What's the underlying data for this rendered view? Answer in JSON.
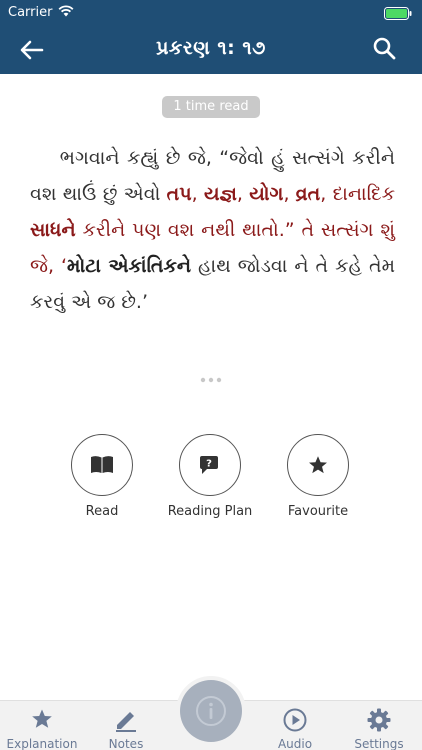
{
  "status_bar": {
    "carrier": "Carrier"
  },
  "nav": {
    "title": "પ્રકરણ ૧: ૧૭"
  },
  "read_badge": "1 time read",
  "verse": {
    "p1": "ભગવાને કહ્યું છે જે, “જેવો હું સત્સંગે કરીને વશ થાઉં છું એવો ",
    "k1": "તપ",
    "s1": ", ",
    "k2": "યજ્ઞ",
    "s2": ", ",
    "k3": "યોગ",
    "s3": ", ",
    "k4": "વ્રત",
    "p2": ", દાનાદિક ",
    "k5": "સાધને",
    "p3": " કરીને પણ વશ નથી થાતો.” તે સત્સંગ શું જે, ‘",
    "k6": "મોટા એકાંતિકને",
    "p4": " હાથ જોડવા ને તે કહે તેમ કરવું એ જ છે.’"
  },
  "actions": [
    {
      "label": "Read",
      "icon": "book-icon"
    },
    {
      "label": "Reading Plan",
      "icon": "reading-plan-icon"
    },
    {
      "label": "Favourite",
      "icon": "star-icon"
    }
  ],
  "tabs": [
    {
      "label": "Explanation",
      "icon": "star-icon"
    },
    {
      "label": "Notes",
      "icon": "pencil-icon"
    },
    {
      "label": "Audio",
      "icon": "play-icon"
    },
    {
      "label": "Settings",
      "icon": "gear-icon"
    }
  ],
  "colors": {
    "nav_bg": "#1f4e75",
    "highlight_red": "#8b1a1a",
    "tab_text": "#6a7a95",
    "fab_bg": "#a7b0bd"
  }
}
